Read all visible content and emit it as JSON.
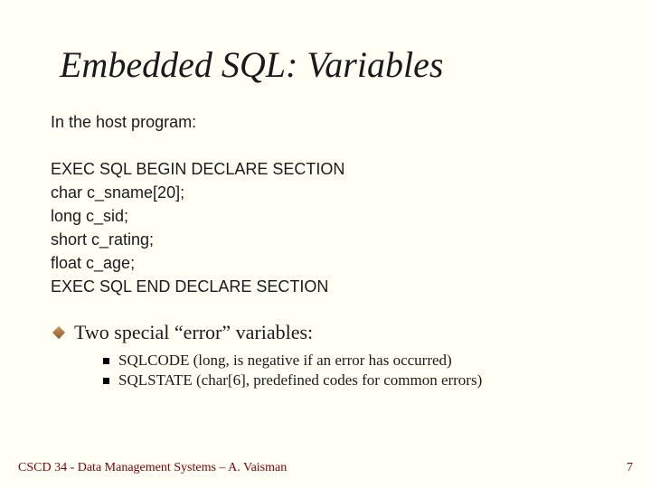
{
  "title": "Embedded SQL: Variables",
  "intro": "In the host program:",
  "code": {
    "l1": "EXEC SQL BEGIN DECLARE SECTION",
    "l2": "char c_sname[20];",
    "l3": "long c_sid;",
    "l4": "short c_rating;",
    "l5": "float c_age;",
    "l6": "EXEC SQL END DECLARE SECTION"
  },
  "bullet": {
    "text": "Two special “error” variables:",
    "sub": [
      "SQLCODE (long, is negative if an error has occurred)",
      "SQLSTATE (char[6], predefined codes for common errors)"
    ]
  },
  "footer": {
    "left": "CSCD 34 - Data Management Systems – A. Vaisman",
    "right": "7"
  }
}
